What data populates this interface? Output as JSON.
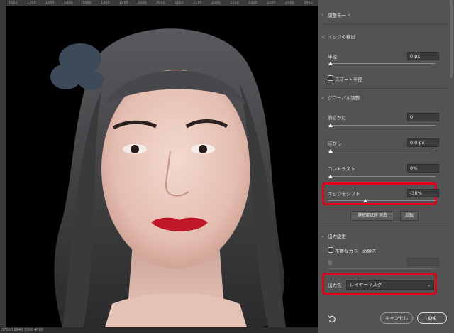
{
  "rulers": {
    "top_ticks": [
      "1650",
      "1700",
      "1750",
      "1800",
      "1850",
      "1900",
      "1950",
      "2000",
      "2050",
      "2100",
      "2150",
      "2200",
      "2250",
      "2300",
      "2350",
      "2400",
      "2450"
    ],
    "status_text": "37000  2940  3700  4000"
  },
  "panel": {
    "view_mode": {
      "label": "調整モード"
    },
    "edge_detection": {
      "title": "エッジの検出",
      "radius_label": "半径",
      "radius_value": "0 px",
      "smart_radius_label": "スマート半径"
    },
    "global_adjust": {
      "title": "グローバル調整",
      "smooth_label": "滑らかに",
      "smooth_value": "0",
      "feather_label": "ぼかし",
      "feather_value": "0.0 px",
      "contrast_label": "コントラスト",
      "contrast_value": "0%",
      "shift_edge_label": "エッジをシフト",
      "shift_edge_value": "-30%",
      "shift_edge_fraction": 0.35,
      "clear_selection_label": "選択範囲を消去",
      "invert_label": "反転"
    },
    "output": {
      "title": "出力設定",
      "decontaminate_label": "不要なカラーの除去",
      "amount_label": "量",
      "output_to_label": "出力先",
      "output_to_value": "レイヤーマスク"
    },
    "footer": {
      "reset_icon": "reset-icon",
      "cancel_label": "キャンセル",
      "ok_label": "OK"
    }
  },
  "colors": {
    "highlight": "#e0001b",
    "panel_bg": "#535353"
  }
}
